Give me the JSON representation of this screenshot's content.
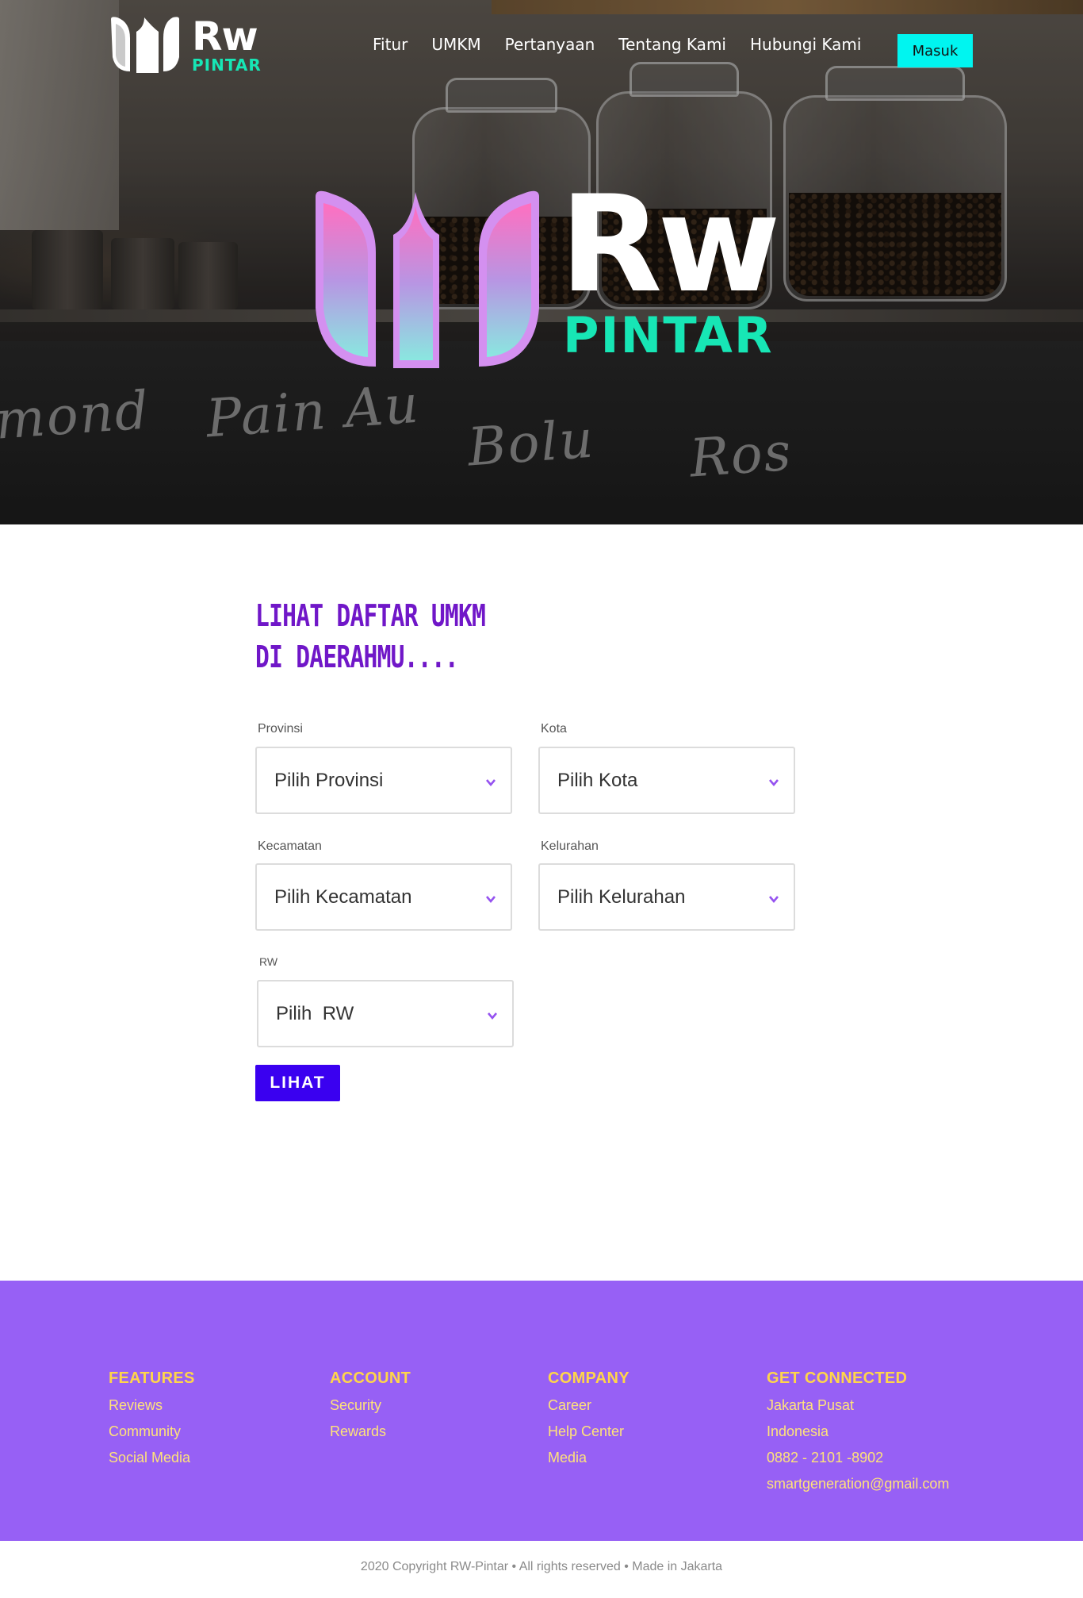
{
  "brand": {
    "name": "Rw",
    "sub": "PINTAR",
    "accent_color": "#17e6b5",
    "logo_gradient": [
      "#ff6fc0",
      "#8ae7e0"
    ]
  },
  "nav": {
    "links": [
      "Fitur",
      "UMKM",
      "Pertanyaan",
      "Tentang Kami",
      "Hubungi Kami"
    ],
    "login_label": "Masuk",
    "login_color": "#00f5f0"
  },
  "hero": {
    "chalk_words": [
      "mond",
      "Pain Au",
      "Bolu",
      "Ros"
    ]
  },
  "search": {
    "title_line1": "LIHAT DAFTAR UMKM",
    "title_line2": "DI DAERAHMU....",
    "title_color": "#7017c8",
    "fields": [
      {
        "label": "Provinsi",
        "placeholder": "Pilih Provinsi"
      },
      {
        "label": "Kota",
        "placeholder": "Pilih Kota"
      },
      {
        "label": "Kecamatan",
        "placeholder": "Pilih Kecamatan"
      },
      {
        "label": "Kelurahan",
        "placeholder": "Pilih Kelurahan"
      },
      {
        "label": "RW",
        "placeholder": "Pilih  RW"
      }
    ],
    "submit_label": "LIHAT",
    "submit_color": "#3a00f0"
  },
  "footer": {
    "background": "#9760f5",
    "columns": [
      {
        "heading": "FEATURES",
        "items": [
          "Reviews",
          "Community",
          "Social Media"
        ]
      },
      {
        "heading": "ACCOUNT",
        "items": [
          "Security",
          "Rewards"
        ]
      },
      {
        "heading": "COMPANY",
        "items": [
          "Career",
          "Help Center",
          "Media"
        ]
      },
      {
        "heading": "GET CONNECTED",
        "items": [
          "Jakarta Pusat",
          "Indonesia",
          "0882 - 2101 -8902",
          "smartgeneration@gmail.com"
        ]
      }
    ],
    "copyright": "2020 Copyright RW-Pintar • All rights reserved • Made in Jakarta"
  }
}
